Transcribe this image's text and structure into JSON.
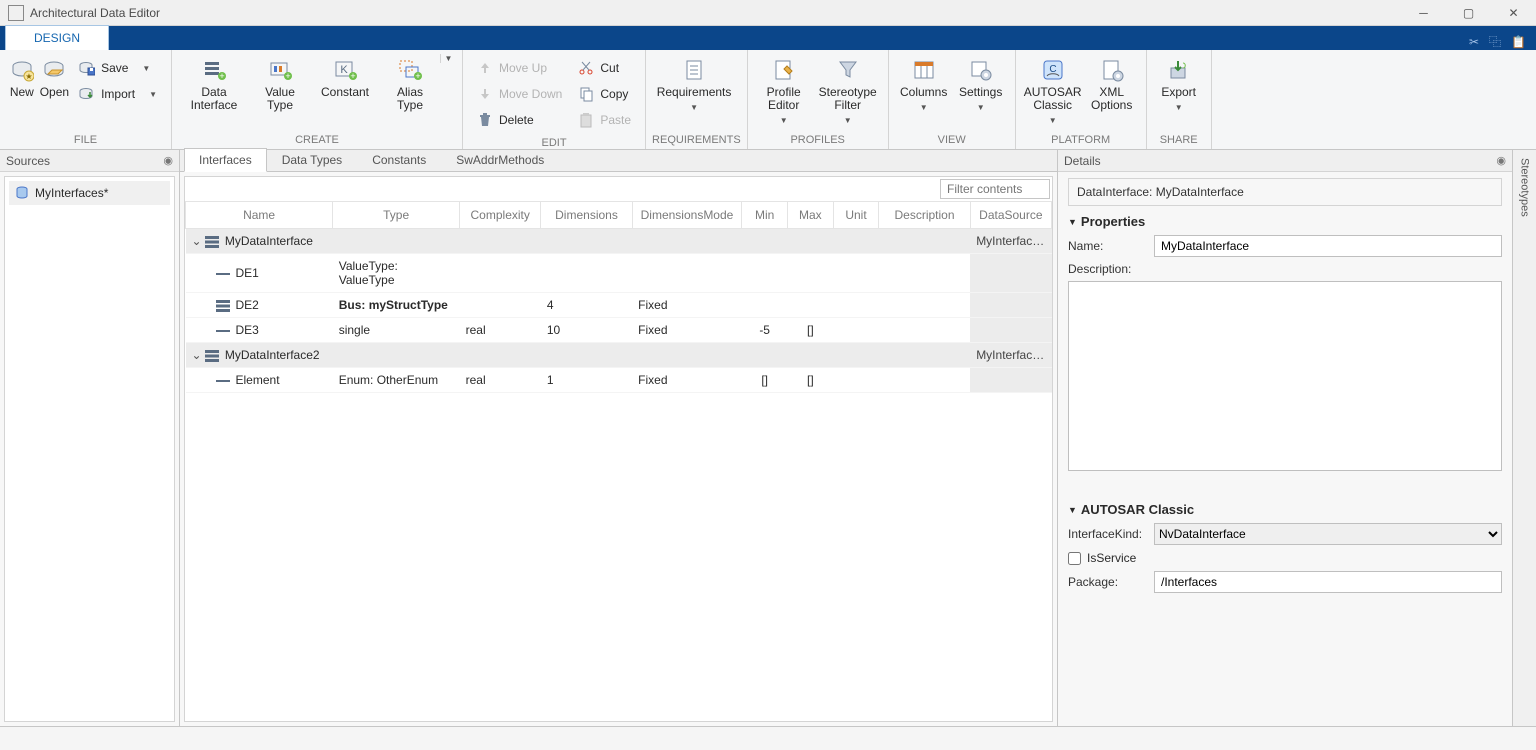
{
  "window": {
    "title": "Architectural Data Editor"
  },
  "ribbon": {
    "tab": "DESIGN",
    "file": {
      "new": "New",
      "open": "Open",
      "save": "Save",
      "import": "Import",
      "label": "FILE"
    },
    "create": {
      "data_interface": "Data\nInterface",
      "value_type": "Value\nType",
      "constant": "Constant",
      "alias_type": "Alias\nType",
      "label": "CREATE"
    },
    "edit": {
      "move_up": "Move Up",
      "move_down": "Move Down",
      "delete": "Delete",
      "cut": "Cut",
      "copy": "Copy",
      "paste": "Paste",
      "label": "EDIT"
    },
    "requirements": {
      "btn": "Requirements",
      "label": "REQUIREMENTS"
    },
    "profiles": {
      "editor": "Profile\nEditor",
      "filter": "Stereotype\nFilter",
      "label": "PROFILES"
    },
    "view": {
      "columns": "Columns",
      "settings": "Settings",
      "label": "VIEW"
    },
    "platform": {
      "autosar": "AUTOSAR\nClassic",
      "xml": "XML\nOptions",
      "label": "PLATFORM"
    },
    "share": {
      "export": "Export",
      "label": "SHARE"
    }
  },
  "sources": {
    "title": "Sources",
    "items": [
      "MyInterfaces*"
    ]
  },
  "subtabs": [
    "Interfaces",
    "Data Types",
    "Constants",
    "SwAddrMethods"
  ],
  "filter_placeholder": "Filter contents",
  "columns": [
    "Name",
    "Type",
    "Complexity",
    "Dimensions",
    "DimensionsMode",
    "Min",
    "Max",
    "Unit",
    "Description",
    "DataSource"
  ],
  "rows": [
    {
      "level": 0,
      "icon": "struct",
      "name": "MyDataInterface",
      "ds": "MyInterface..."
    },
    {
      "level": 1,
      "icon": "line",
      "name": "DE1",
      "type": "ValueType: ValueType"
    },
    {
      "level": 1,
      "icon": "struct",
      "name": "DE2",
      "type": "Bus: myStructType",
      "type_bold": true,
      "dim": "4",
      "dmode": "Fixed"
    },
    {
      "level": 1,
      "icon": "line",
      "name": "DE3",
      "type": "single",
      "cx": "real",
      "dim": "10",
      "dmode": "Fixed",
      "min": "-5",
      "max": "[]"
    },
    {
      "level": 0,
      "icon": "struct",
      "name": "MyDataInterface2",
      "ds": "MyInterface..."
    },
    {
      "level": 1,
      "icon": "line",
      "name": "Element",
      "type": "Enum: OtherEnum",
      "cx": "real",
      "dim": "1",
      "dmode": "Fixed",
      "min": "[]",
      "max": "[]"
    }
  ],
  "details": {
    "title": "Details",
    "header": "DataInterface: MyDataInterface",
    "properties_label": "Properties",
    "name_label": "Name:",
    "name_value": "MyDataInterface",
    "description_label": "Description:",
    "autosar_label": "AUTOSAR Classic",
    "ifkind_label": "InterfaceKind:",
    "ifkind_value": "NvDataInterface",
    "isservice_label": "IsService",
    "package_label": "Package:",
    "package_value": "/Interfaces"
  },
  "stereotypes_label": "Stereotypes"
}
